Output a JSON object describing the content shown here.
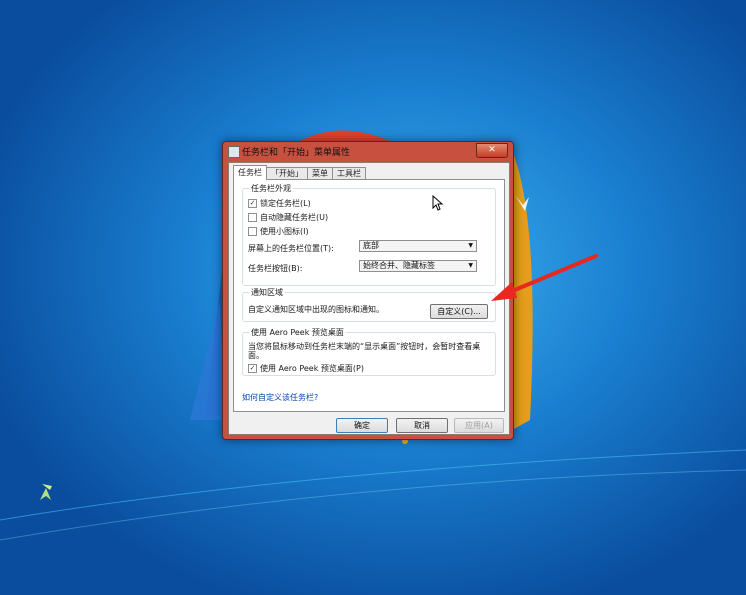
{
  "desktop": {
    "colors": {
      "background": "#1576c8",
      "arrow": "#e8271f"
    }
  },
  "dialog": {
    "title": "任务栏和「开始」菜单属性",
    "close_label": "✕",
    "tabs": [
      {
        "label": "任务栏"
      },
      {
        "label": "「开始」"
      },
      {
        "label": "菜单"
      },
      {
        "label": "工具栏"
      }
    ],
    "appearance": {
      "title": "任务栏外观",
      "options": [
        {
          "label": "锁定任务栏(L)",
          "checked": "✓"
        },
        {
          "label": "自动隐藏任务栏(U)",
          "checked": ""
        },
        {
          "label": "使用小图标(I)",
          "checked": ""
        }
      ],
      "position_label": "屏幕上的任务栏位置(T):",
      "position_value": "底部",
      "buttons_label": "任务栏按钮(B):",
      "buttons_value": "始终合并、隐藏标签"
    },
    "notification": {
      "title": "通知区域",
      "description": "自定义通知区域中出现的图标和通知。",
      "customize_button": "自定义(C)..."
    },
    "aero_peek": {
      "title": "使用 Aero Peek 预览桌面",
      "description": "当您将鼠标移动到任务栏末端的“显示桌面”按钮时，会暂时查看桌面。",
      "option_label": "使用 Aero Peek 预览桌面(P)",
      "option_checked": "✓"
    },
    "help_link": "如何自定义该任务栏?",
    "ok_button": "确定",
    "cancel_button": "取消",
    "apply_button": "应用(A)"
  }
}
